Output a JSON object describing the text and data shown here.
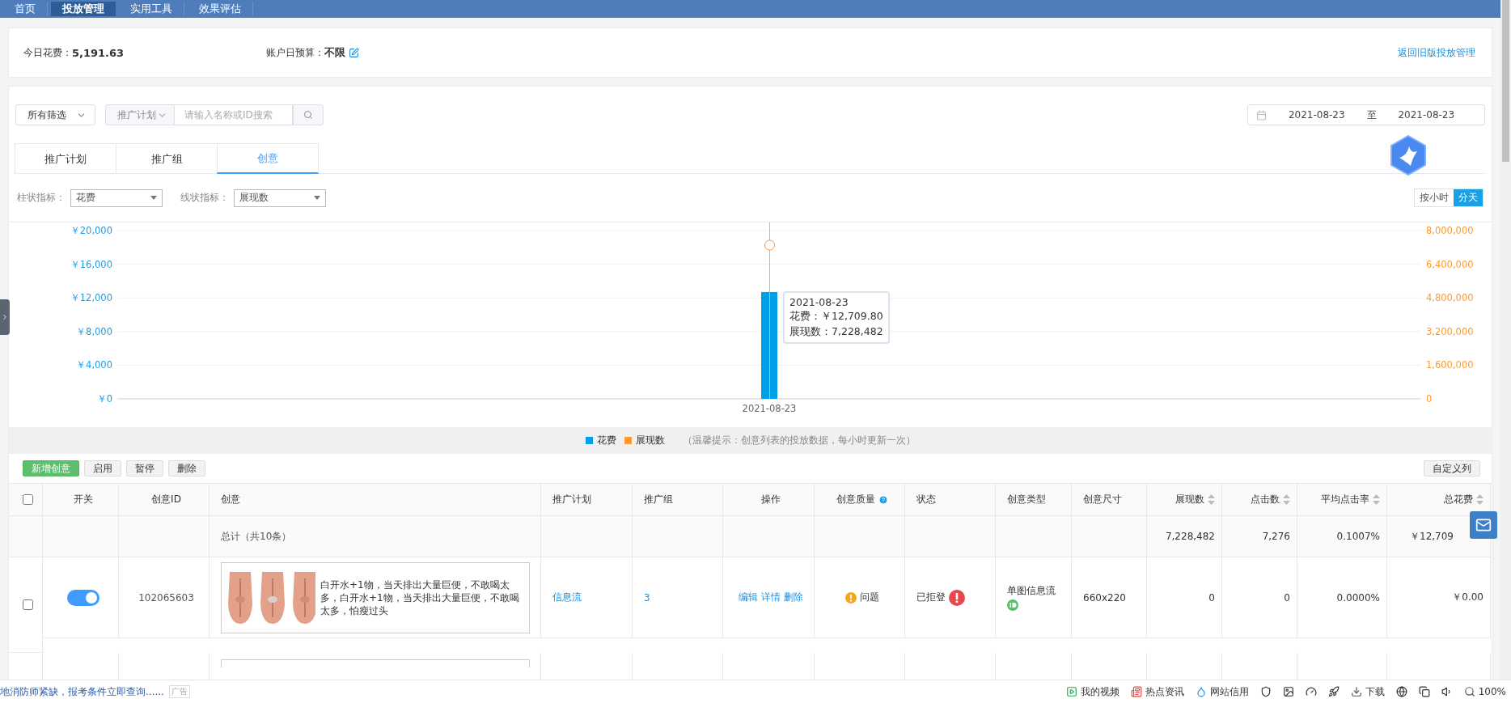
{
  "nav": [
    {
      "label": "首页",
      "selected": false
    },
    {
      "label": "投放管理",
      "selected": true
    },
    {
      "label": "实用工具",
      "selected": false
    },
    {
      "label": "效果评估",
      "selected": false
    }
  ],
  "summary": {
    "spend_label": "今日花费：",
    "spend": "5,191.63",
    "budget_label": "账户日预算：",
    "budget": "不限",
    "old_version_link": "返回旧版投放管理"
  },
  "filters": {
    "all_filter": "所有筛选",
    "scope": "推广计划",
    "search_placeholder": "请输入名称或ID搜索",
    "date_from": "2021-08-23",
    "date_sep": "至",
    "date_to": "2021-08-23"
  },
  "tabs": [
    {
      "label": "推广计划",
      "selected": false
    },
    {
      "label": "推广组",
      "selected": false
    },
    {
      "label": "创意",
      "selected": true
    }
  ],
  "indicators": {
    "bar_label": "柱状指标：",
    "bar_value": "花费",
    "line_label": "线状指标：",
    "line_value": "展现数"
  },
  "granularity": [
    {
      "label": "按小时",
      "selected": false
    },
    {
      "label": "分天",
      "selected": true
    }
  ],
  "chart": {
    "chart_data": {
      "type": "bar",
      "grid": true,
      "categories": [
        "2021-08-23"
      ],
      "series": [
        {
          "name": "花费",
          "color": "#00a0e9",
          "values": [
            12700
          ]
        }
      ],
      "ylim": [
        0,
        20000
      ],
      "yticks": [
        {
          "value": 0,
          "label": "￥0"
        },
        {
          "value": 4000,
          "label": "￥4,000"
        },
        {
          "value": 8000,
          "label": "￥8,000"
        },
        {
          "value": 12000,
          "label": "￥12,000"
        },
        {
          "value": 16000,
          "label": "￥16,000"
        },
        {
          "value": 20000,
          "label": "￥20,000"
        }
      ]
    },
    "right_axis_labels": [
      "8,000,000",
      "6,400,000",
      "4,800,000",
      "3,200,000",
      "1,600,000",
      "0"
    ],
    "line_series": {
      "name": "展现数",
      "color": "#ff9933"
    },
    "tooltip": {
      "title": "2021-08-23",
      "lines": [
        "花费：￥12,709.80",
        "展现数：7,228,482"
      ]
    },
    "note": "（温馨提示：创意列表的投放数据，每小时更新一次）"
  },
  "toolbar": {
    "buttons": [
      {
        "label": "新增创意",
        "kind": "primary"
      },
      {
        "label": "启用",
        "kind": "plain"
      },
      {
        "label": "暂停",
        "kind": "plain"
      },
      {
        "label": "删除",
        "kind": "plain"
      }
    ],
    "customize": "自定义列"
  },
  "table": {
    "header_checked": false,
    "columns": [
      {
        "label": "开关"
      },
      {
        "label": "创意ID"
      },
      {
        "label": "创意"
      },
      {
        "label": "推广计划"
      },
      {
        "label": "推广组"
      },
      {
        "label": "操作"
      },
      {
        "label": "创意质量",
        "help": true
      },
      {
        "label": "状态"
      },
      {
        "label": "创意类型"
      },
      {
        "label": "创意尺寸"
      },
      {
        "label": "展现数",
        "sortable": true
      },
      {
        "label": "点击数",
        "sortable": true
      },
      {
        "label": "平均点击率",
        "sortable": true
      },
      {
        "label": "总花费",
        "sortable": true
      }
    ],
    "total": {
      "label": "总计（共10条）",
      "impressions": "7,228,482",
      "clicks": "7,276",
      "ctr": "0.1007%",
      "spend": "￥12,709"
    },
    "rows": [
      {
        "checked": false,
        "on": true,
        "id": "102065603",
        "creative": {
          "kind": "picture",
          "text": "白开水+1物，当天排出大量巨便，不敢喝太多，白开水+1物，当天排出大量巨便，不敢喝太多，怕瘦过头"
        },
        "plan": "信息流",
        "group": "3",
        "actions": [
          "编辑",
          "详情",
          "删除"
        ],
        "quality": "问题",
        "status": "已拒登",
        "type": "单图信息流",
        "size": "660x220",
        "impressions": "0",
        "clicks": "0",
        "ctr": "0.0000%",
        "spend": "￥0.00"
      }
    ]
  },
  "status_bar": {
    "ad_text": "地消防师紧缺，报考条件立即查询......",
    "ad_tag": "广告",
    "items": [
      {
        "kind": "video",
        "label": "我的视频"
      },
      {
        "kind": "news",
        "label": "热点资讯"
      },
      {
        "kind": "credit",
        "label": "网站信用"
      },
      {
        "kind": "download",
        "label": "下载"
      },
      {
        "kind": "zoom",
        "label": "100%"
      }
    ]
  }
}
